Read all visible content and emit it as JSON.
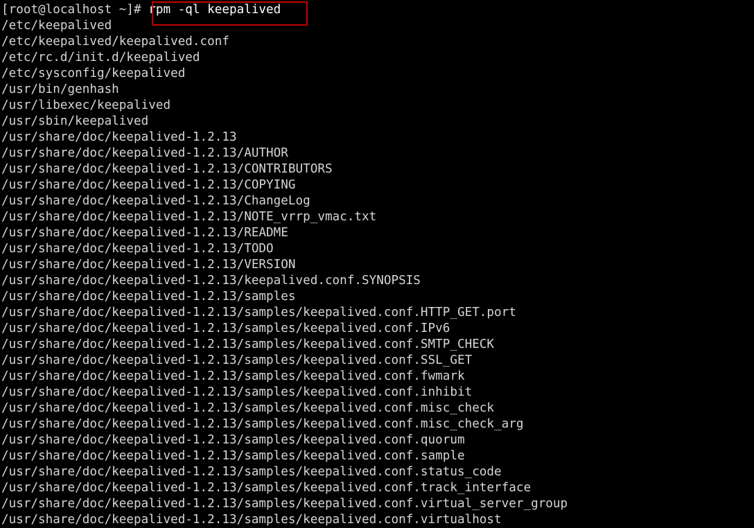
{
  "terminal": {
    "background_color": "#000000",
    "text_color": "#d6d6d6",
    "highlight_color": "#c00000",
    "prompt": "[root@localhost ~]# ",
    "command": "rpm -ql keepalived",
    "output_lines": [
      "/etc/keepalived",
      "/etc/keepalived/keepalived.conf",
      "/etc/rc.d/init.d/keepalived",
      "/etc/sysconfig/keepalived",
      "/usr/bin/genhash",
      "/usr/libexec/keepalived",
      "/usr/sbin/keepalived",
      "/usr/share/doc/keepalived-1.2.13",
      "/usr/share/doc/keepalived-1.2.13/AUTHOR",
      "/usr/share/doc/keepalived-1.2.13/CONTRIBUTORS",
      "/usr/share/doc/keepalived-1.2.13/COPYING",
      "/usr/share/doc/keepalived-1.2.13/ChangeLog",
      "/usr/share/doc/keepalived-1.2.13/NOTE_vrrp_vmac.txt",
      "/usr/share/doc/keepalived-1.2.13/README",
      "/usr/share/doc/keepalived-1.2.13/TODO",
      "/usr/share/doc/keepalived-1.2.13/VERSION",
      "/usr/share/doc/keepalived-1.2.13/keepalived.conf.SYNOPSIS",
      "/usr/share/doc/keepalived-1.2.13/samples",
      "/usr/share/doc/keepalived-1.2.13/samples/keepalived.conf.HTTP_GET.port",
      "/usr/share/doc/keepalived-1.2.13/samples/keepalived.conf.IPv6",
      "/usr/share/doc/keepalived-1.2.13/samples/keepalived.conf.SMTP_CHECK",
      "/usr/share/doc/keepalived-1.2.13/samples/keepalived.conf.SSL_GET",
      "/usr/share/doc/keepalived-1.2.13/samples/keepalived.conf.fwmark",
      "/usr/share/doc/keepalived-1.2.13/samples/keepalived.conf.inhibit",
      "/usr/share/doc/keepalived-1.2.13/samples/keepalived.conf.misc_check",
      "/usr/share/doc/keepalived-1.2.13/samples/keepalived.conf.misc_check_arg",
      "/usr/share/doc/keepalived-1.2.13/samples/keepalived.conf.quorum",
      "/usr/share/doc/keepalived-1.2.13/samples/keepalived.conf.sample",
      "/usr/share/doc/keepalived-1.2.13/samples/keepalived.conf.status_code",
      "/usr/share/doc/keepalived-1.2.13/samples/keepalived.conf.track_interface",
      "/usr/share/doc/keepalived-1.2.13/samples/keepalived.conf.virtual_server_group",
      "/usr/share/doc/keepalived-1.2.13/samples/keepalived.conf.virtualhost"
    ]
  }
}
